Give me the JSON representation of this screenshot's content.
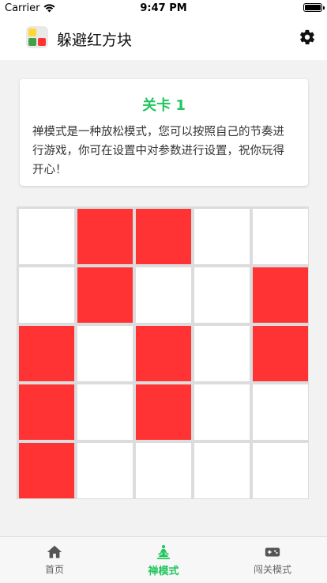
{
  "status_bar": {
    "carrier": "Carrier",
    "time": "9:47 PM"
  },
  "header": {
    "title": "躲避红方块",
    "logo_colors": [
      "#fdd835",
      "#43a047",
      "#ff3333",
      "#e9e9e9"
    ]
  },
  "level_card": {
    "title": "关卡 1",
    "description": "禅模式是一种放松模式，您可以按照自己的节奏进行游戏，你可在设置中对参数进行设置，祝你玩得开心！"
  },
  "grid": {
    "rows": 5,
    "cols": 5,
    "cells": [
      [
        0,
        1,
        1,
        0,
        0
      ],
      [
        0,
        1,
        0,
        0,
        1
      ],
      [
        1,
        0,
        1,
        0,
        1
      ],
      [
        1,
        0,
        1,
        0,
        0
      ],
      [
        1,
        0,
        0,
        0,
        0
      ]
    ],
    "red_color": "#ff3333",
    "empty_color": "#ffffff"
  },
  "tabs": [
    {
      "label": "首页",
      "icon": "home-icon",
      "active": false
    },
    {
      "label": "禅模式",
      "icon": "meditation-icon",
      "active": true
    },
    {
      "label": "闯关模式",
      "icon": "gamepad-icon",
      "active": false
    }
  ],
  "colors": {
    "accent": "#22c55e",
    "tab_inactive": "#666666"
  }
}
